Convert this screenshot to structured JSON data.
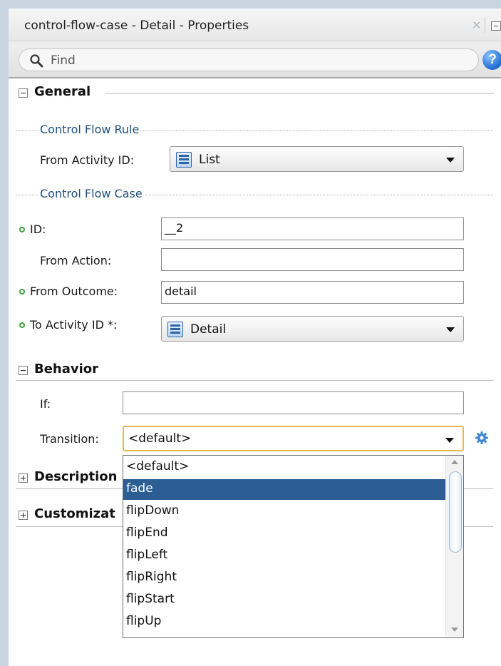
{
  "window": {
    "title": "control-flow-case - Detail - Properties",
    "close_glyph": "×"
  },
  "search": {
    "placeholder": "Find",
    "help_glyph": "?"
  },
  "sections": {
    "general": {
      "title": "General",
      "control_flow_rule_label": "Control Flow Rule",
      "from_activity_id_label": "From Activity ID:",
      "from_activity_id_value": "List",
      "control_flow_case_label": "Control Flow Case",
      "id_label": "ID:",
      "id_value": "__2",
      "from_action_label": "From Action:",
      "from_action_value": "",
      "from_outcome_label": "From Outcome:",
      "from_outcome_value": "detail",
      "to_activity_id_label": "To Activity ID *:",
      "to_activity_id_value": "Detail"
    },
    "behavior": {
      "title": "Behavior",
      "if_label": "If:",
      "if_value": "",
      "transition_label": "Transition:",
      "transition_value": "<default>"
    },
    "description": {
      "title": "Description"
    },
    "customization": {
      "title": "Customizat"
    }
  },
  "transition_options": [
    "<default>",
    "fade",
    "flipDown",
    "flipEnd",
    "flipLeft",
    "flipRight",
    "flipStart",
    "flipUp"
  ],
  "transition_selected_option": "fade",
  "colors": {
    "accent_selected": "#2d5e93",
    "required_indicator": "#3aa13a",
    "focus_border": "#e6b74f",
    "group_label": "#1f4f7f"
  },
  "icons": {
    "search": "search-icon",
    "help": "help-icon",
    "activity": "activity-icon",
    "gear": "gear-icon",
    "expand": "expand-icon",
    "collapse": "collapse-icon",
    "dropdown_arrow": "chevron-down-icon"
  }
}
